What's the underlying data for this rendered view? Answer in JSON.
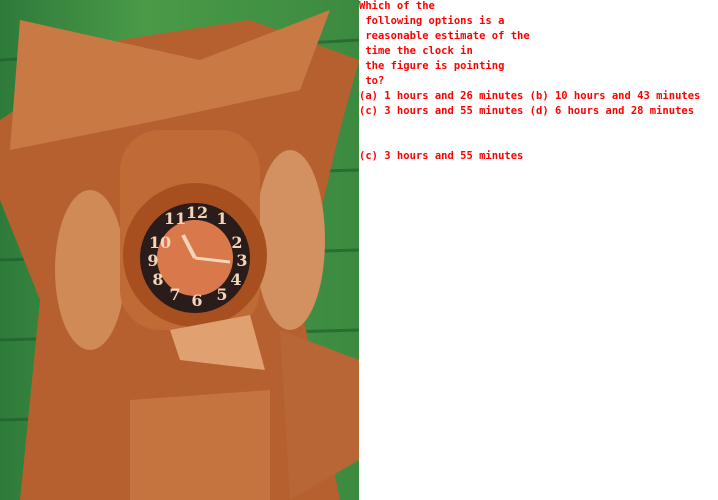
{
  "question_lines": [
    "Which of the",
    " following options is a",
    " reasonable estimate of the",
    " time the clock in",
    " the figure is pointing",
    " to?",
    "(a) 1 hours and 26 minutes (b) 10 hours and 43 minutes",
    "(c) 3 hours and 55 minutes (d) 6 hours and 28 minutes"
  ],
  "answer": "(c) 3 hours and 55 minutes",
  "text_color": "#ff0000",
  "image": {
    "subject": "carved wooden cuckoo clock",
    "dial_numerals": [
      "12",
      "1",
      "2",
      "3",
      "4",
      "5",
      "6",
      "7",
      "8",
      "9",
      "10",
      "11"
    ]
  }
}
